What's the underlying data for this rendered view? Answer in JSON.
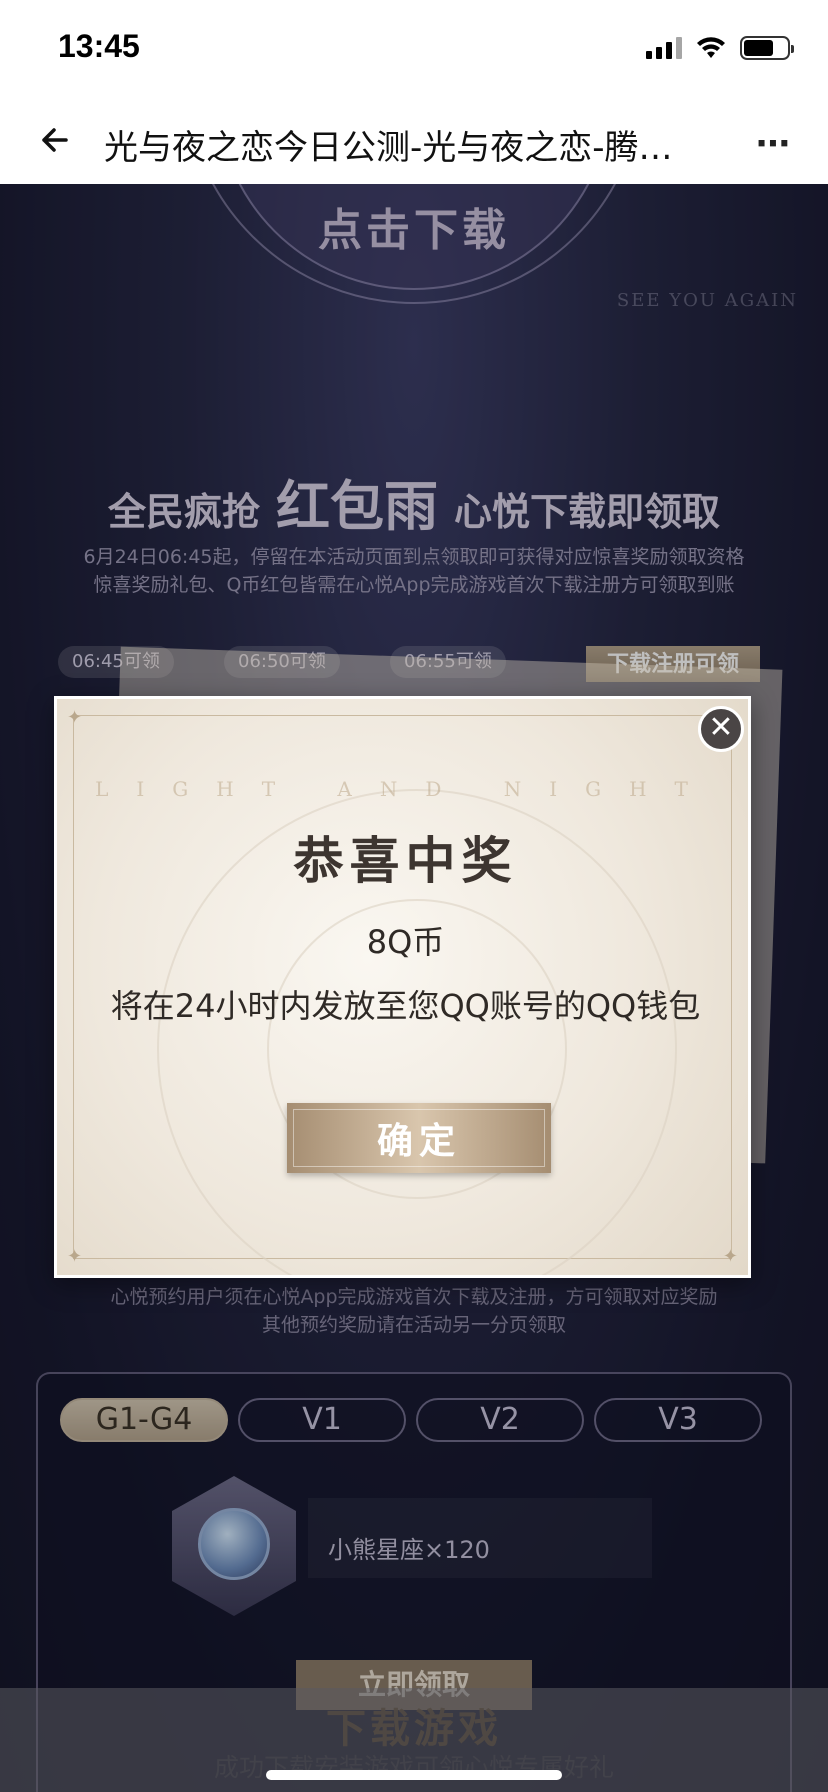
{
  "status_bar": {
    "time": "13:45"
  },
  "nav": {
    "title": "光与夜之恋今日公测-光与夜之恋-腾…"
  },
  "page": {
    "download_top": "点击下载",
    "see_you": "SEE YOU AGAIN",
    "hongbao": {
      "title_left": "全民疯抢",
      "title_main": "红包雨",
      "title_right": "心悦下载即领取",
      "desc_line1": "6月24日06:45起，停留在本活动页面到点领取即可获得对应惊喜奖励领取资格",
      "desc_line2": "惊喜奖励礼包、Q币红包皆需在心悦App完成游戏首次下载注册方可领取到账",
      "time_slots": [
        "06:45可领",
        "06:50可领",
        "06:55可领"
      ],
      "register_label": "下载注册可领"
    },
    "note_line1": "心悦预约用户须在心悦App完成游戏首次下载及注册，方可领取对应奖励",
    "note_line2": "其他预约奖励请在活动另一分页领取",
    "tiers": [
      "G1-G4",
      "V1",
      "V2",
      "V3"
    ],
    "reward": {
      "name": "小熊星座×120",
      "claim_label": "立即领取"
    },
    "download_bar": {
      "title": "下载游戏",
      "subtitle": "成功下载安装游戏可领心悦专属好礼"
    }
  },
  "modal": {
    "latin": "LIGHT AND NIGHT",
    "title": "恭喜中奖",
    "amount": "8Q币",
    "message": "将在24小时内发放至您QQ账号的QQ钱包",
    "confirm_label": "确定",
    "close_symbol": "✕"
  }
}
